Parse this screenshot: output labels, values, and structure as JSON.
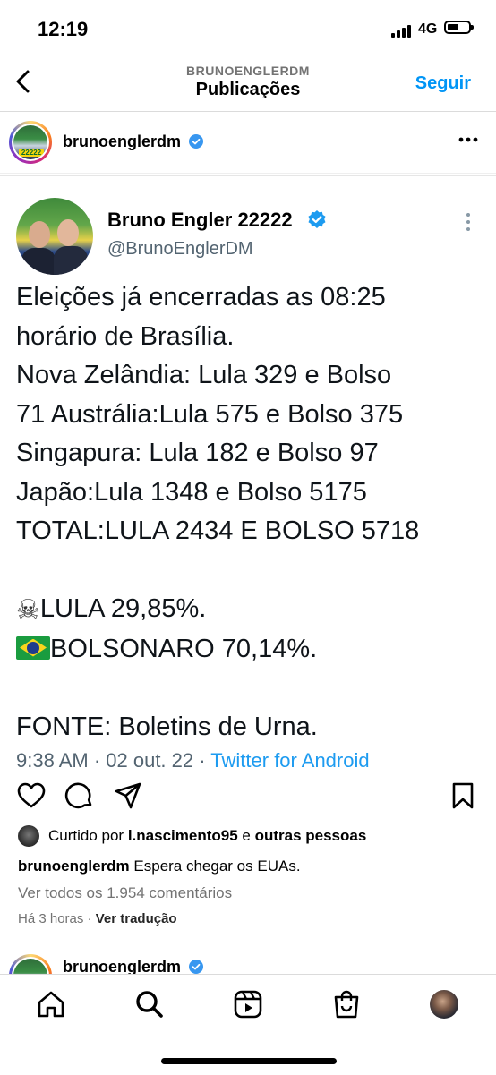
{
  "status_bar": {
    "time": "12:19",
    "network": "4G"
  },
  "nav": {
    "account": "BRUNOENGLERDM",
    "title": "Publicações",
    "follow": "Seguir"
  },
  "post": {
    "username": "brunoenglerdm",
    "avatar_badge": "22222",
    "tweet": {
      "name": "Bruno Engler 22222",
      "handle": "@BrunoEnglerDM",
      "lines": [
        "Eleições já encerradas as 08:25",
        "horário de Brasília.",
        "Nova Zelândia: Lula 329 e Bolso",
        "71 Austrália:Lula 575 e Bolso 375",
        "Singapura: Lula 182 e Bolso 97",
        "Japão:Lula 1348 e Bolso 5175",
        "TOTAL:LULA 2434 E BOLSO 5718",
        "",
        "LULA 29,85%.",
        "BOLSONARO 70,14%.",
        "",
        "FONTE: Boletins de Urna."
      ],
      "meta_time": "9:38 AM · 02 out. 22 · ",
      "meta_source": "Twitter for Android"
    },
    "liked": {
      "prefix": "Curtido por ",
      "user": "l.nascimento95",
      "mid": " e ",
      "others": "outras pessoas"
    },
    "caption": {
      "user": "brunoenglerdm",
      "text": " Espera chegar os EUAs."
    },
    "comments": "Ver todos os 1.954 comentários",
    "time_ago": "Há 3 horas",
    "translate": "Ver tradução"
  },
  "next_post": {
    "username": "brunoenglerdm"
  },
  "tabbar": {
    "items": [
      "home-icon",
      "search-icon",
      "reels-icon",
      "shop-icon",
      "profile-avatar"
    ]
  },
  "colors": {
    "accent": "#0095f6",
    "twitter_blue": "#1d9bf0",
    "muted": "#737373"
  }
}
